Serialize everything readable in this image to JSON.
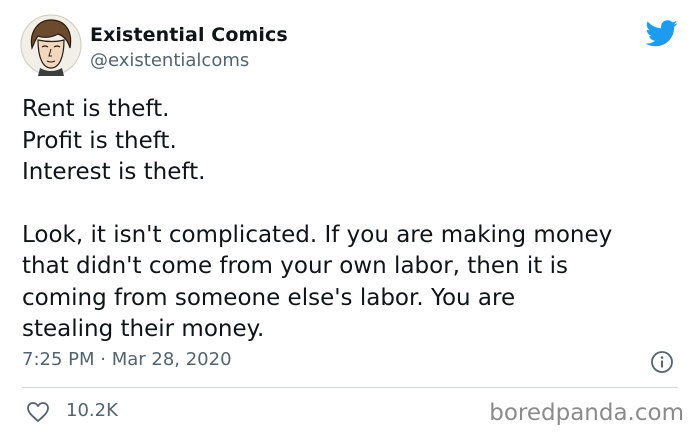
{
  "author": {
    "display_name": "Existential Comics",
    "handle": "@existentialcoms",
    "avatar_icon": "avatar-portrait-illustration"
  },
  "tweet": {
    "lines": [
      "Rent is theft.",
      "Profit is theft.",
      "Interest is theft."
    ],
    "paragraph_lines": [
      "Look, it isn't complicated. If you are making money",
      "that didn't come from your own labor, then it is",
      "coming from someone else's labor. You are",
      "stealing their money."
    ],
    "timestamp": "7:25 PM · Mar 28, 2020"
  },
  "footer": {
    "like_count": "10.2K",
    "watermark": "boredpanda.com"
  },
  "colors": {
    "twitter_blue": "#1d9bf0",
    "text": "#0f1419",
    "secondary_text": "#536471",
    "divider": "#cfd9de",
    "watermark": "#8b8b8b"
  }
}
